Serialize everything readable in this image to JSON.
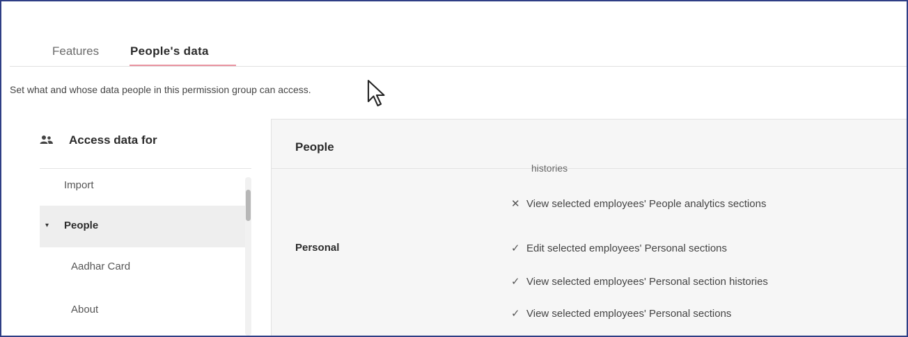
{
  "tabs": {
    "features": "Features",
    "people_data": "People's data"
  },
  "description": "Set what and whose data people in this permission group can access.",
  "sidebar": {
    "header": "Access data for",
    "items": {
      "import": "Import",
      "people": "People",
      "aadhar": "Aadhar Card",
      "about": "About"
    }
  },
  "panel": {
    "title": "People",
    "section": "Personal",
    "truncated_text": "histories",
    "permissions": [
      {
        "mark": "✕",
        "text": "View selected employees' People analytics sections"
      },
      {
        "mark": "✓",
        "text": "Edit selected employees' Personal sections"
      },
      {
        "mark": "✓",
        "text": "View selected employees' Personal section histories"
      },
      {
        "mark": "✓",
        "text": "View selected employees' Personal sections"
      }
    ]
  }
}
